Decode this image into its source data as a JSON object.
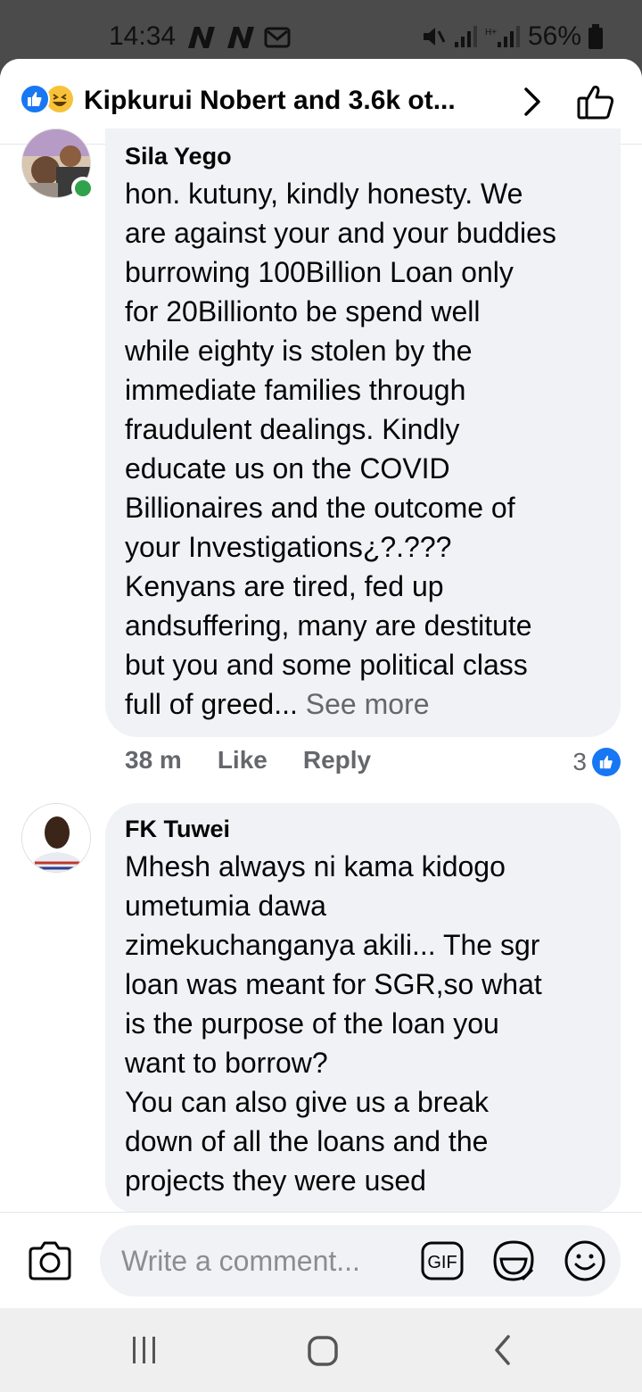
{
  "status_bar": {
    "time": "14:34",
    "battery": "56%"
  },
  "header": {
    "title": "Kipkurui Nobert and 3.6k ot...",
    "icons": [
      "like-reaction-icon",
      "haha-reaction-icon",
      "chevron-right-icon",
      "thumbs-up-outline-icon"
    ]
  },
  "comments": [
    {
      "author": "Sila Yego",
      "text": "hon. kutuny, kindly honesty. We\nare against your and your buddies\nburrowing 100Billion Loan only\nfor 20Billionto be spend well\nwhile eighty is stolen by the\nimmediate families through\nfraudulent dealings. Kindly\neducate us on the COVID\nBillionaires and the outcome of\nyour Investigations¿?.???\nKenyans are tired, fed up\nandsuffering, many are destitute\nbut you and some political class\nfull of greed...",
      "see_more": "See more",
      "time": "38 m",
      "like_label": "Like",
      "reply_label": "Reply",
      "reaction_count": "3"
    },
    {
      "author": "FK Tuwei",
      "text": "Mhesh always ni kama kidogo\numetumia dawa\nzimekuchanganya akili... The sgr\nloan was meant for SGR,so what\nis the purpose of the loan you\nwant to borrow?\nYou can also give us a break\ndown of all the loans and the\nprojects they were used"
    }
  ],
  "composer": {
    "placeholder": "Write a comment...",
    "gif_label": "GIF"
  },
  "colors": {
    "accent": "#1877f2",
    "bubble": "#f0f2f5",
    "secondary_text": "#65676b",
    "online": "#31a24c"
  }
}
